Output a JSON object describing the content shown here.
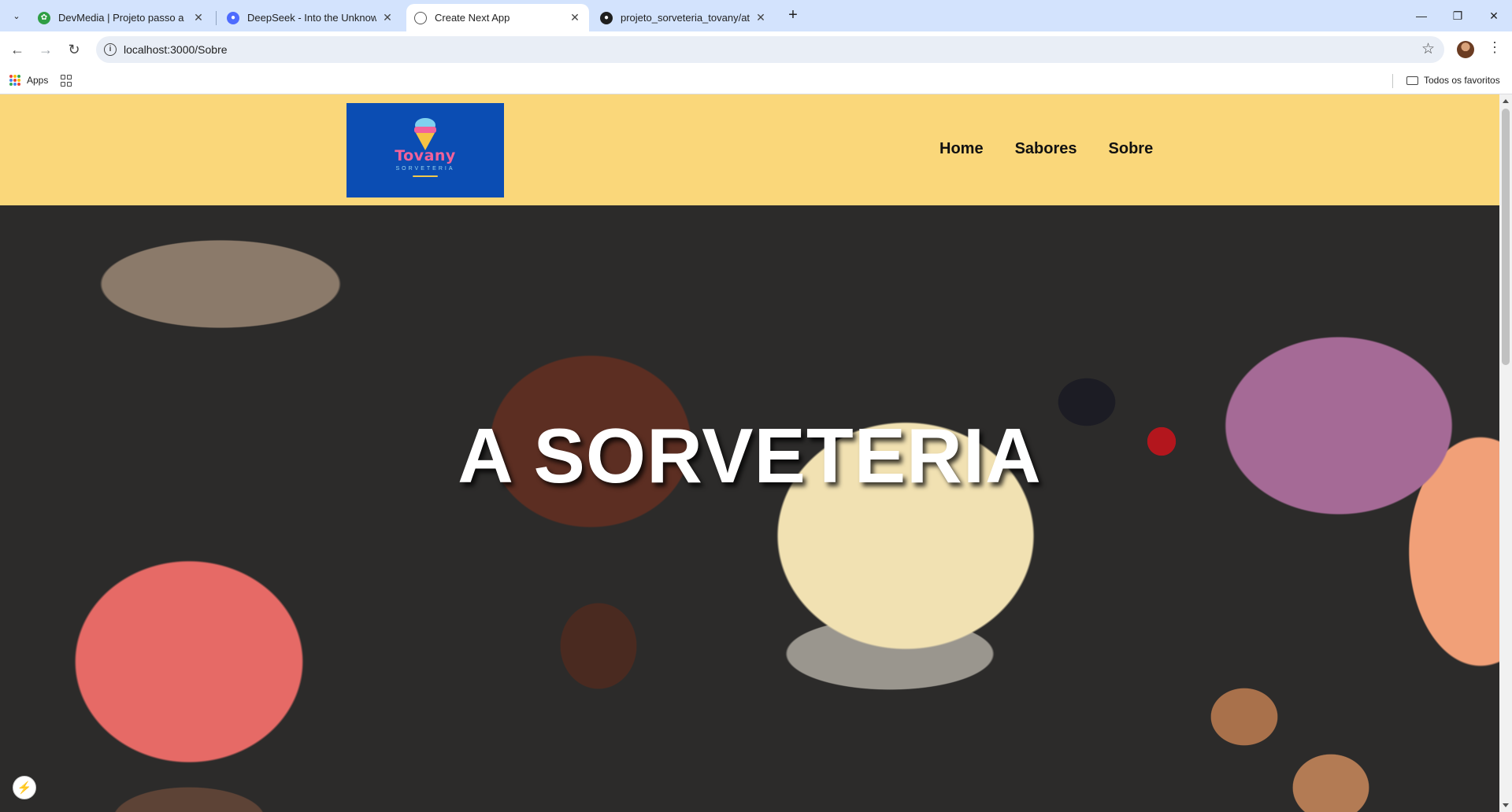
{
  "browser": {
    "tabs": [
      {
        "title": "DevMedia | Projeto passo a pas",
        "favicon": "devmedia-icon",
        "active": false
      },
      {
        "title": "DeepSeek - Into the Unknown",
        "favicon": "deepseek-icon",
        "active": false
      },
      {
        "title": "Create Next App",
        "favicon": "globe-icon",
        "active": true
      },
      {
        "title": "projeto_sorveteria_tovany/at m",
        "favicon": "github-icon",
        "active": false
      }
    ],
    "new_tab_label": "+",
    "url": "localhost:3000/Sobre",
    "bookmarks": {
      "apps_label": "Apps",
      "all_bookmarks_label": "Todos os favoritos"
    }
  },
  "site": {
    "logo": {
      "name": "Tovany",
      "subtitle": "SORVETERIA"
    },
    "nav": [
      {
        "label": "Home"
      },
      {
        "label": "Sabores"
      },
      {
        "label": "Sobre"
      }
    ],
    "hero": {
      "title": "A SORVETERIA"
    }
  },
  "colors": {
    "header_bg": "#fad77a",
    "logo_bg": "#0b4db3",
    "logo_text": "#f2629a",
    "tabstrip_bg": "#d3e3fd"
  }
}
